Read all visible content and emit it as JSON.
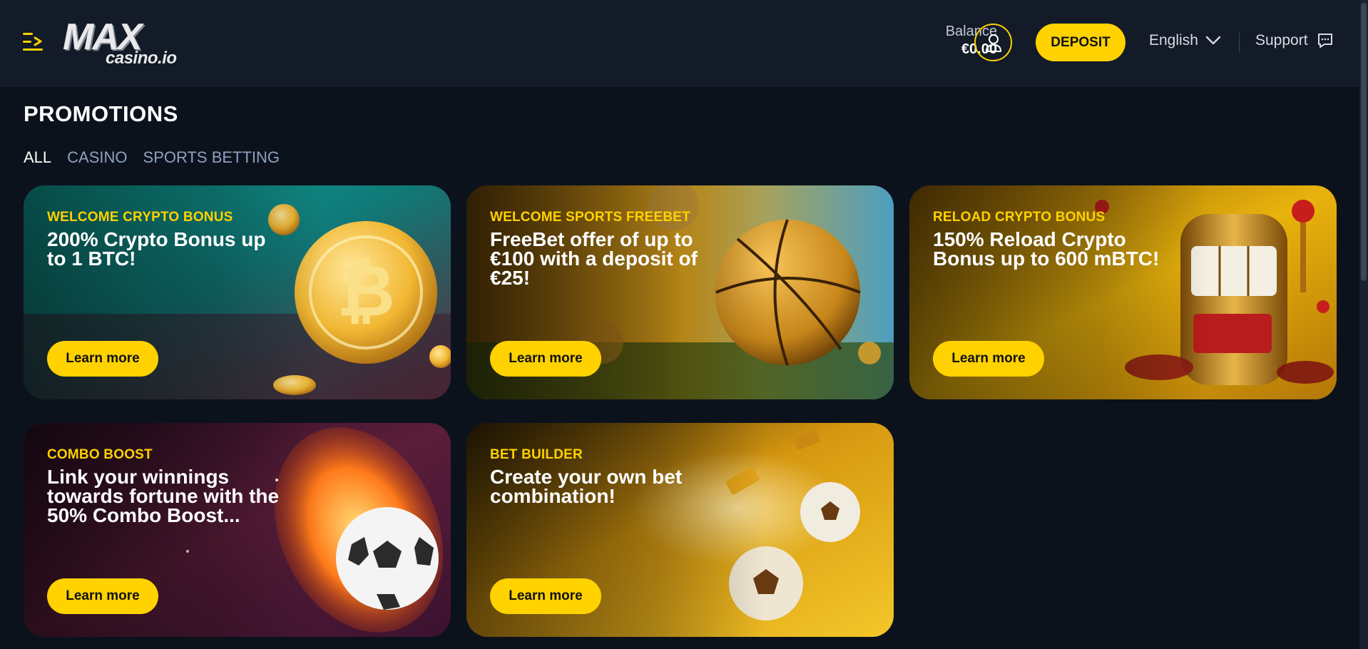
{
  "header": {
    "logo_main": "MAX",
    "logo_sub": "casino.io",
    "balance_label": "Balance",
    "balance_value": "€0.00",
    "deposit_label": "DEPOSIT",
    "language": "English",
    "support_label": "Support"
  },
  "page": {
    "title": "PROMOTIONS",
    "tabs": [
      {
        "label": "ALL",
        "active": true
      },
      {
        "label": "CASINO",
        "active": false
      },
      {
        "label": "SPORTS BETTING",
        "active": false
      }
    ]
  },
  "promotions": [
    {
      "tag": "WELCOME CRYPTO BONUS",
      "headline": "200% Crypto Bonus up to 1 BTC!",
      "cta": "Learn more"
    },
    {
      "tag": "WELCOME SPORTS FREEBET",
      "headline": "FreeBet offer of up to €100 with a deposit of €25!",
      "cta": "Learn more"
    },
    {
      "tag": "RELOAD CRYPTO BONUS",
      "headline": "150% Reload Crypto Bonus up to 600 mBTC!",
      "cta": "Learn more"
    },
    {
      "tag": "COMBO BOOST",
      "headline": "Link your winnings towards fortune with the 50% Combo Boost...",
      "cta": "Learn more"
    },
    {
      "tag": "BET BUILDER",
      "headline": "Create your own bet combination!",
      "cta": "Learn more"
    }
  ],
  "colors": {
    "accent": "#ffd200",
    "background": "#0c121c",
    "header": "#121b27",
    "tab_inactive": "#8ea2c0"
  },
  "icons": [
    "menu-icon",
    "user-icon",
    "chevron-down-icon",
    "chat-icon"
  ]
}
